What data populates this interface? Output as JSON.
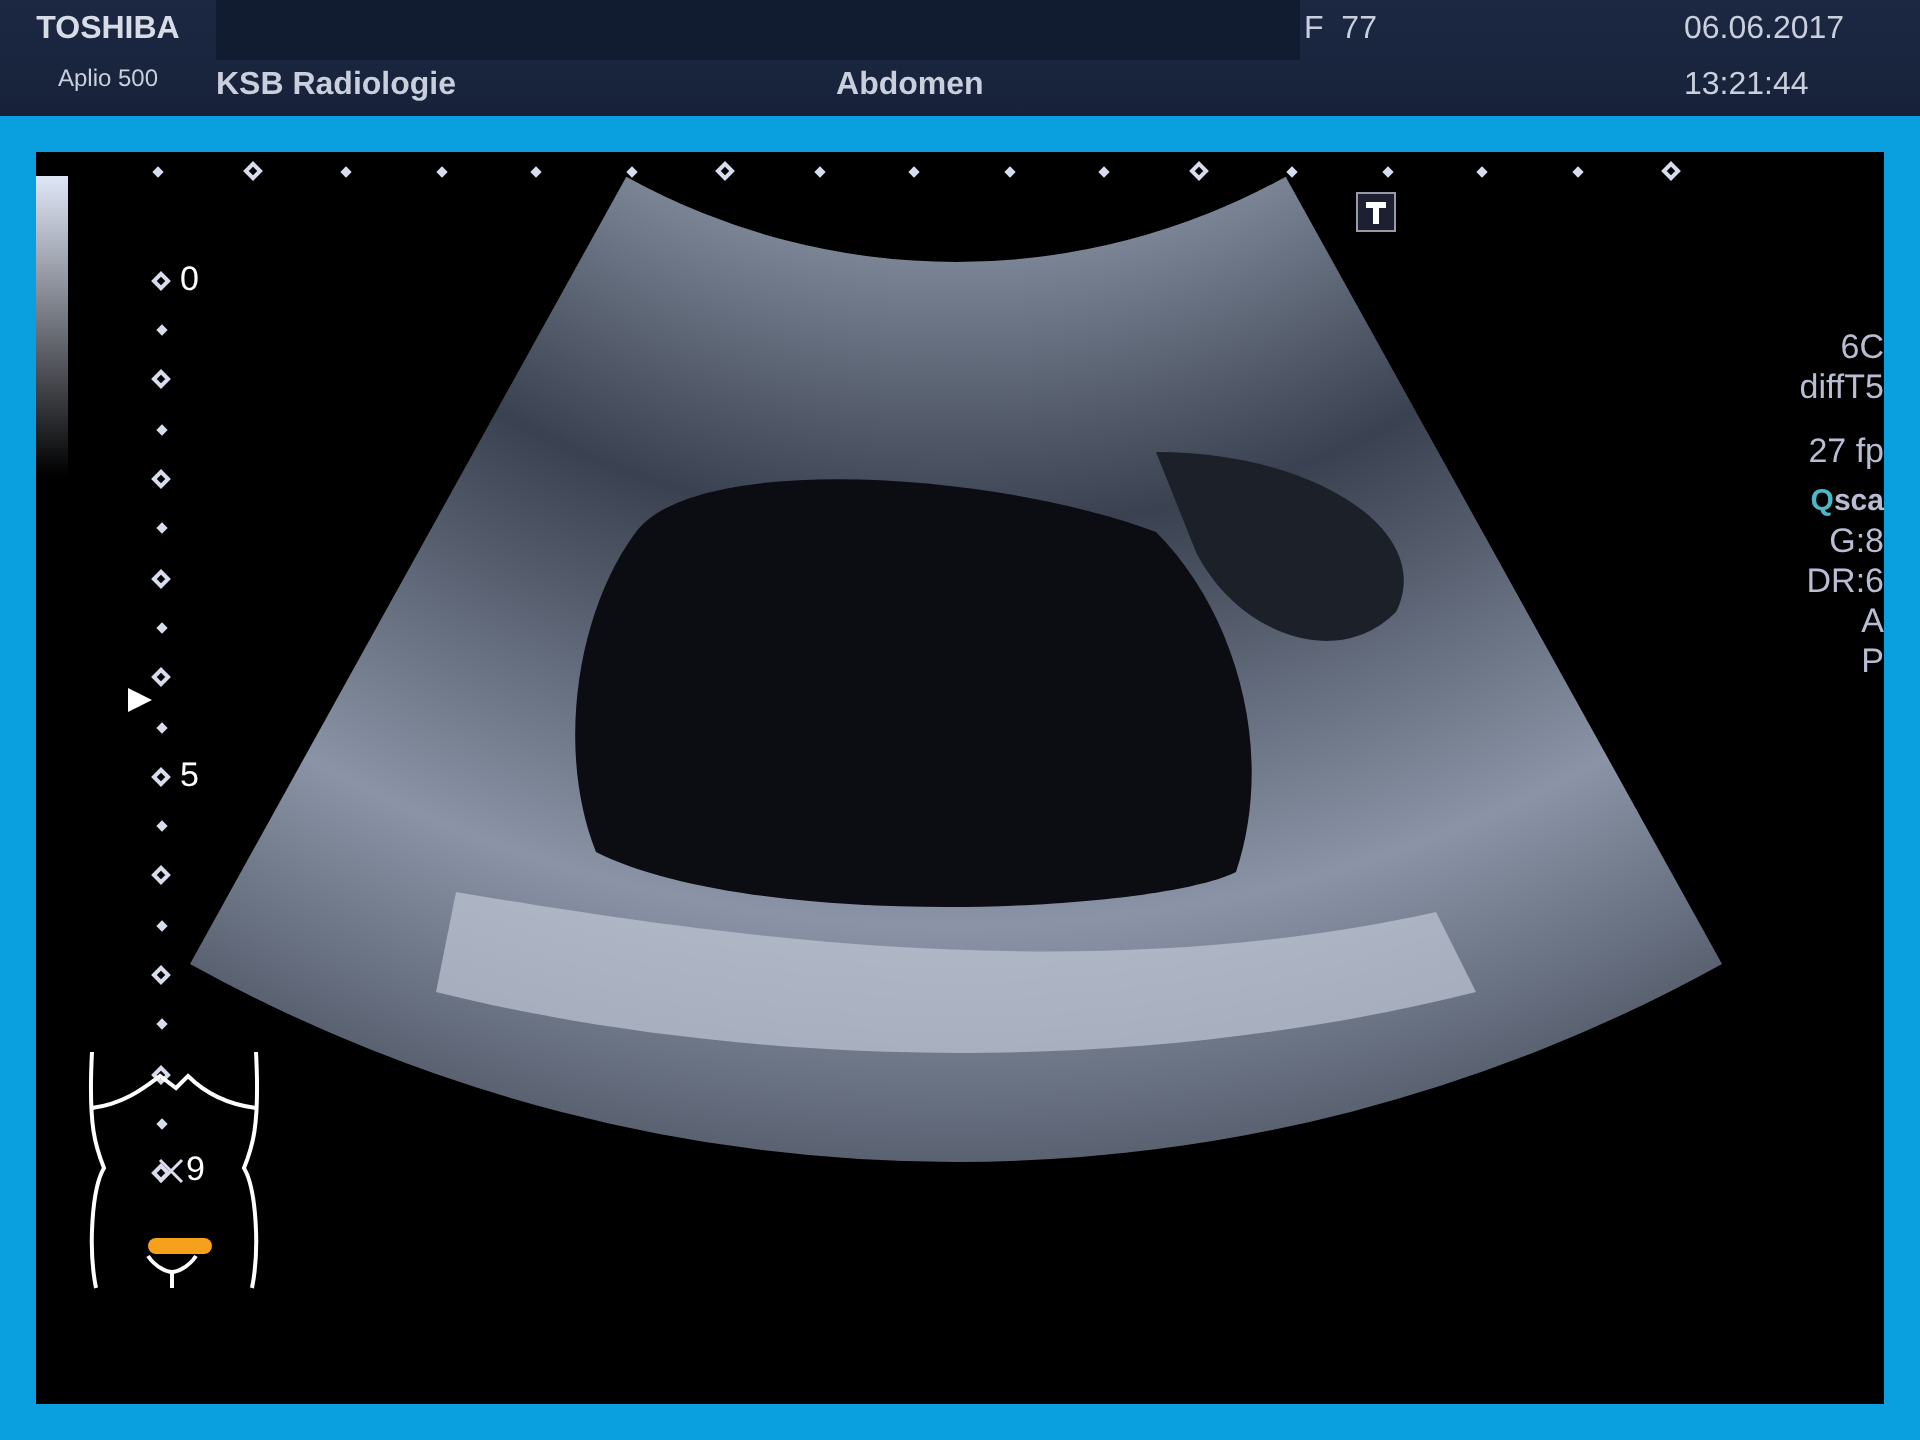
{
  "header": {
    "brand": "TOSHIBA",
    "model": "Aplio 500",
    "institution": "KSB Radiologie",
    "preset": "Abdomen",
    "frame_label": "F",
    "frame_value": "77",
    "date": "06.06.2017",
    "time": "13:21:44"
  },
  "depth_scale": {
    "labels": [
      "0",
      "5"
    ]
  },
  "body_mark": {
    "label": "9"
  },
  "params": [
    {
      "kind": "plain",
      "text": "6C"
    },
    {
      "kind": "plain",
      "text": "diffT5"
    },
    {
      "kind": "plain",
      "text": "27 fp"
    },
    {
      "kind": "qscan",
      "prefix": "Q",
      "text": "sca"
    },
    {
      "kind": "plain",
      "text": "G:8"
    },
    {
      "kind": "plain",
      "text": "DR:6"
    },
    {
      "kind": "plain",
      "text": "A"
    },
    {
      "kind": "plain",
      "text": "P"
    }
  ]
}
